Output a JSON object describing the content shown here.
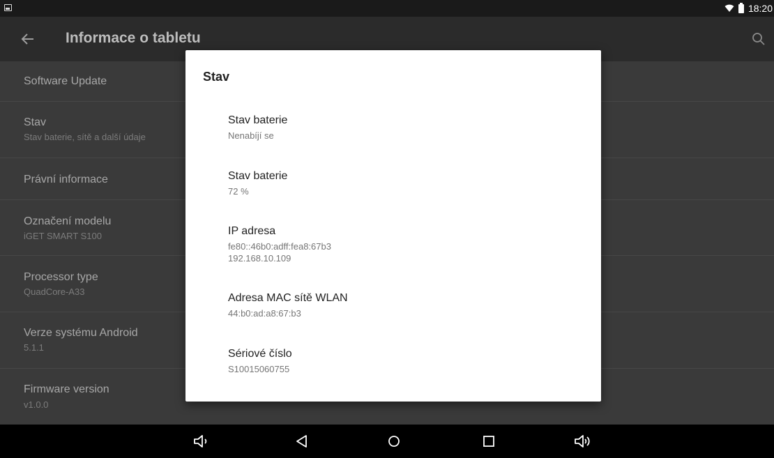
{
  "status_bar": {
    "time": "18:20",
    "icons": [
      "notification-icon",
      "wifi-icon",
      "battery-icon"
    ]
  },
  "toolbar": {
    "title": "Informace o tabletu",
    "back_icon": "arrow-back-icon",
    "search_icon": "search-icon"
  },
  "settings_list": [
    {
      "title": "Software Update",
      "subtitle": ""
    },
    {
      "title": "Stav",
      "subtitle": "Stav baterie, sítě a další údaje"
    },
    {
      "title": "Právní informace",
      "subtitle": ""
    },
    {
      "title": "Označení modelu",
      "subtitle": "iGET SMART S100"
    },
    {
      "title": "Processor type",
      "subtitle": "QuadCore-A33"
    },
    {
      "title": "Verze systému Android",
      "subtitle": "5.1.1"
    },
    {
      "title": "Firmware version",
      "subtitle": "v1.0.0"
    }
  ],
  "dialog": {
    "title": "Stav",
    "items": [
      {
        "label": "Stav baterie",
        "value": "Nenabíjí se"
      },
      {
        "label": "Stav baterie",
        "value": "72 %"
      },
      {
        "label": "IP adresa",
        "value": "fe80::46b0:adff:fea8:67b3",
        "value2": "192.168.10.109"
      },
      {
        "label": "Adresa MAC sítě WLAN",
        "value": "44:b0:ad:a8:67:b3"
      },
      {
        "label": "Sériové číslo",
        "value": "S10015060755"
      }
    ]
  },
  "nav_bar": {
    "buttons": [
      "volume-down-icon",
      "back-icon",
      "home-icon",
      "recents-icon",
      "volume-up-icon"
    ]
  },
  "colors": {
    "status_bar_bg": "#1a1a1a",
    "toolbar_bg": "#2b2b2b",
    "list_bg_dimmed": "#3a3a3a",
    "dialog_bg": "#ffffff",
    "nav_bg": "#000000"
  }
}
